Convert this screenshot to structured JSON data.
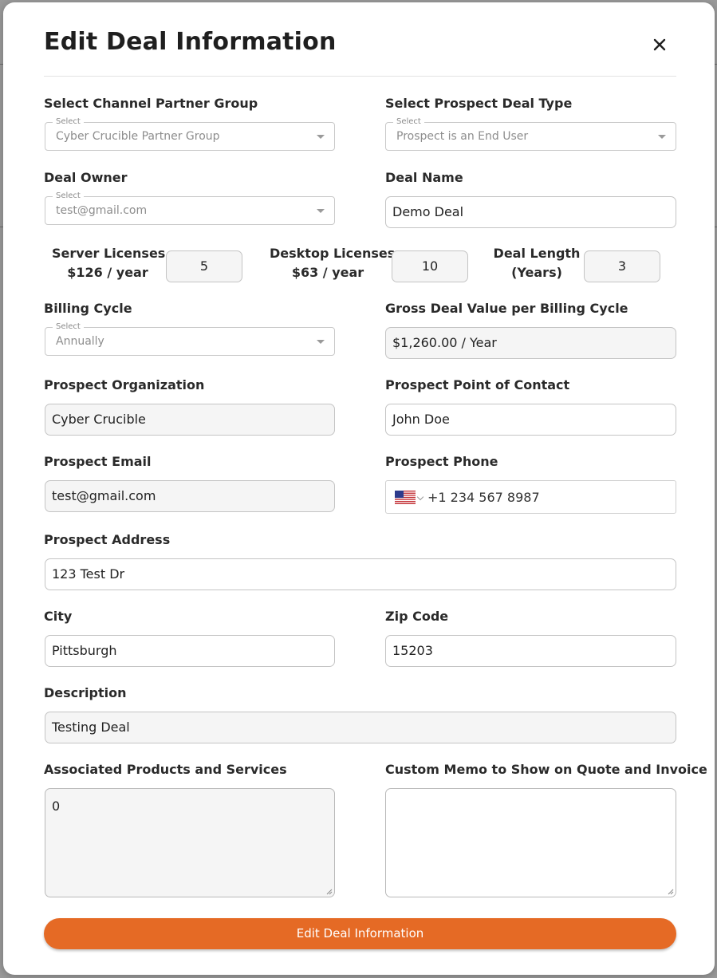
{
  "modal": {
    "title": "Edit Deal Information",
    "submit_label": "Edit Deal Information"
  },
  "fields": {
    "channel_partner_group": {
      "label": "Select Channel Partner Group",
      "legend": "Select",
      "value": "Cyber Crucible Partner Group"
    },
    "prospect_deal_type": {
      "label": "Select Prospect Deal Type",
      "legend": "Select",
      "value": "Prospect is an End User"
    },
    "deal_owner": {
      "label": "Deal Owner",
      "legend": "Select",
      "value": "test@gmail.com"
    },
    "deal_name": {
      "label": "Deal Name",
      "value": "Demo Deal"
    },
    "server_licenses": {
      "label_line1": "Server Licenses",
      "label_line2": "$126 / year",
      "value": "5"
    },
    "desktop_licenses": {
      "label_line1": "Desktop Licenses",
      "label_line2": "$63 / year",
      "value": "10"
    },
    "deal_length": {
      "label_line1": "Deal Length",
      "label_line2": "(Years)",
      "value": "3"
    },
    "billing_cycle": {
      "label": "Billing Cycle",
      "legend": "Select",
      "value": "Annually"
    },
    "gross_deal_value": {
      "label": "Gross Deal Value per Billing Cycle",
      "value": "$1,260.00 / Year"
    },
    "prospect_organization": {
      "label": "Prospect Organization",
      "value": "Cyber Crucible"
    },
    "prospect_point_of_contact": {
      "label": "Prospect Point of Contact",
      "value": "John Doe"
    },
    "prospect_email": {
      "label": "Prospect Email",
      "value": "test@gmail.com"
    },
    "prospect_phone": {
      "label": "Prospect Phone",
      "value": "+1 234 567 8987",
      "flag_icon": "us-flag-icon"
    },
    "prospect_address": {
      "label": "Prospect Address",
      "value": "123 Test Dr"
    },
    "city": {
      "label": "City",
      "value": "Pittsburgh"
    },
    "zip_code": {
      "label": "Zip Code",
      "value": "15203"
    },
    "description": {
      "label": "Description",
      "value": "Testing Deal"
    },
    "associated_products": {
      "label": "Associated Products and Services",
      "value": "0"
    },
    "custom_memo": {
      "label": "Custom Memo to Show on Quote and Invoice",
      "value": ""
    }
  },
  "colors": {
    "accent": "#e56a25",
    "input_border": "#c4c4c4",
    "readonly_background": "#f5f5f5"
  }
}
